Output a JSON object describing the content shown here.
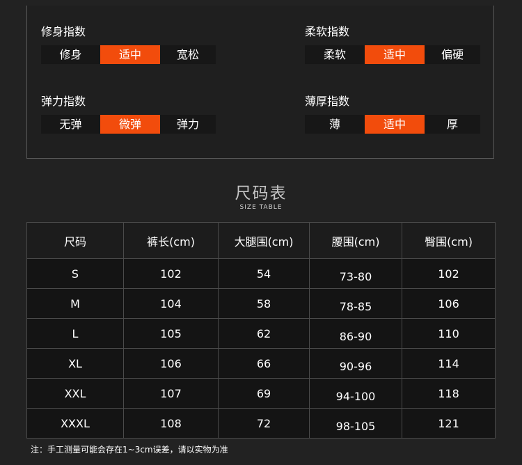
{
  "indices": [
    {
      "title": "修身指数",
      "options": [
        "修身",
        "适中",
        "宽松"
      ],
      "active": 1
    },
    {
      "title": "柔软指数",
      "options": [
        "柔软",
        "适中",
        "偏硬"
      ],
      "active": 1
    },
    {
      "title": "弹力指数",
      "options": [
        "无弹",
        "微弹",
        "弹力"
      ],
      "active": 1
    },
    {
      "title": "薄厚指数",
      "options": [
        "薄",
        "适中",
        "厚"
      ],
      "active": 1
    }
  ],
  "size_table": {
    "title": "尺码表",
    "subtitle": "SIZE TABLE",
    "headers": [
      "尺码",
      "裤长(cm)",
      "大腿围(cm)",
      "腰围(cm)",
      "臀围(cm)"
    ],
    "rows": [
      [
        "S",
        "102",
        "54",
        "73-80",
        "102"
      ],
      [
        "M",
        "104",
        "58",
        "78-85",
        "106"
      ],
      [
        "L",
        "105",
        "62",
        "86-90",
        "110"
      ],
      [
        "XL",
        "106",
        "66",
        "90-96",
        "114"
      ],
      [
        "XXL",
        "107",
        "69",
        "94-100",
        "118"
      ],
      [
        "XXXL",
        "108",
        "72",
        "98-105",
        "121"
      ]
    ]
  },
  "footnote": "注：手工测量可能会存在1~3cm误差，请以实物为准",
  "colors": {
    "accent": "#f24c0c",
    "background": "#222222"
  }
}
